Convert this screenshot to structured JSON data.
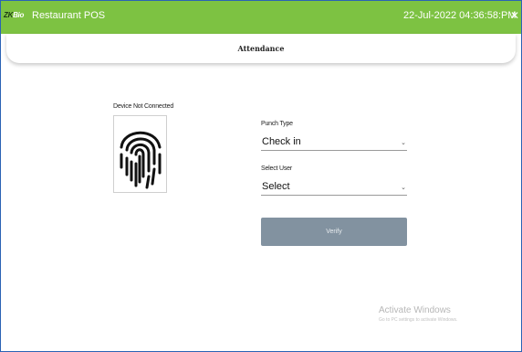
{
  "titlebar": {
    "brand_mark": "ZK",
    "brand_rest": "Bio",
    "app_title": "Restaurant POS",
    "datetime": "22-Jul-2022 04:36:58:PM",
    "close_glyph": "✕"
  },
  "header": {
    "title": "Attendance"
  },
  "device": {
    "status": "Device Not Connected",
    "icon": "fingerprint-icon"
  },
  "form": {
    "punch_type_label": "Punch Type",
    "punch_type_value": "Check in",
    "select_user_label": "Select User",
    "select_user_value": "Select",
    "chevron": "⌄",
    "verify_label": "Verify"
  },
  "watermark": {
    "title": "Activate Windows",
    "subtitle": "Go to PC settings to activate Windows."
  },
  "colors": {
    "titlebar_bg": "#7dc242",
    "verify_bg": "#8292a0",
    "frame_border": "#2b63b5"
  }
}
